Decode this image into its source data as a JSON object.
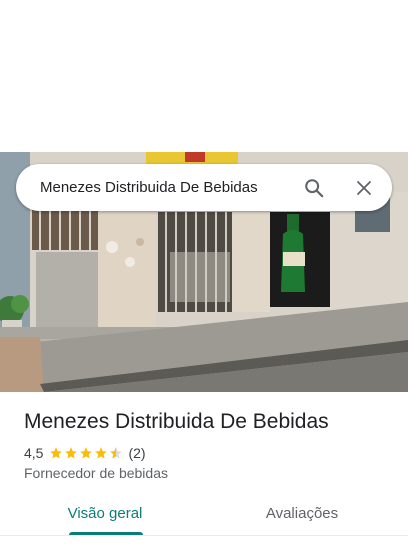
{
  "search": {
    "query": "Menezes Distribuida De Bebidas"
  },
  "place": {
    "name": "Menezes Distribuida De Bebidas",
    "rating": "4,5",
    "rating_value": 4.5,
    "review_count": "(2)",
    "category": "Fornecedor de bebidas"
  },
  "tabs": [
    {
      "label": "Visão geral",
      "active": true
    },
    {
      "label": "Avaliações",
      "active": false
    }
  ],
  "colors": {
    "accent": "#0b7d77",
    "star": "#fbbc04"
  },
  "icons": [
    "search-icon",
    "close-icon",
    "star-icon"
  ]
}
